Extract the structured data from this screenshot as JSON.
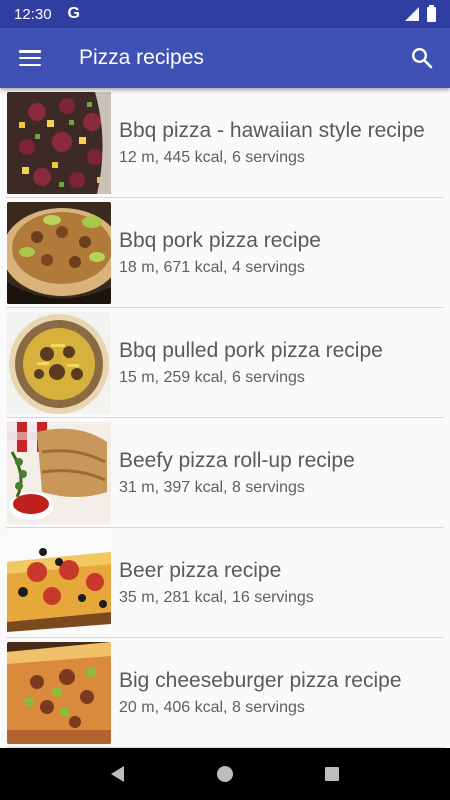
{
  "status_bar": {
    "time": "12:30",
    "g_label": "G"
  },
  "app_bar": {
    "title": "Pizza recipes",
    "menu_icon": "menu-icon",
    "search_icon": "search-icon"
  },
  "recipes": [
    {
      "title": "Bbq pizza - hawaiian style recipe",
      "meta": "12 m, 445 kcal, 6 servings"
    },
    {
      "title": "Bbq pork pizza recipe",
      "meta": "18 m, 671 kcal, 4 servings"
    },
    {
      "title": "Bbq pulled pork pizza recipe",
      "meta": "15 m, 259 kcal, 6 servings"
    },
    {
      "title": "Beefy pizza roll-up recipe",
      "meta": "31 m, 397 kcal, 8 servings"
    },
    {
      "title": "Beer pizza recipe",
      "meta": "35 m, 281 kcal, 16 servings"
    },
    {
      "title": "Big cheeseburger pizza recipe",
      "meta": "20 m, 406 kcal, 8 servings"
    }
  ],
  "colors": {
    "status_bar": "#2f3ea0",
    "app_bar": "#3f51b5",
    "background": "#fafafa"
  }
}
